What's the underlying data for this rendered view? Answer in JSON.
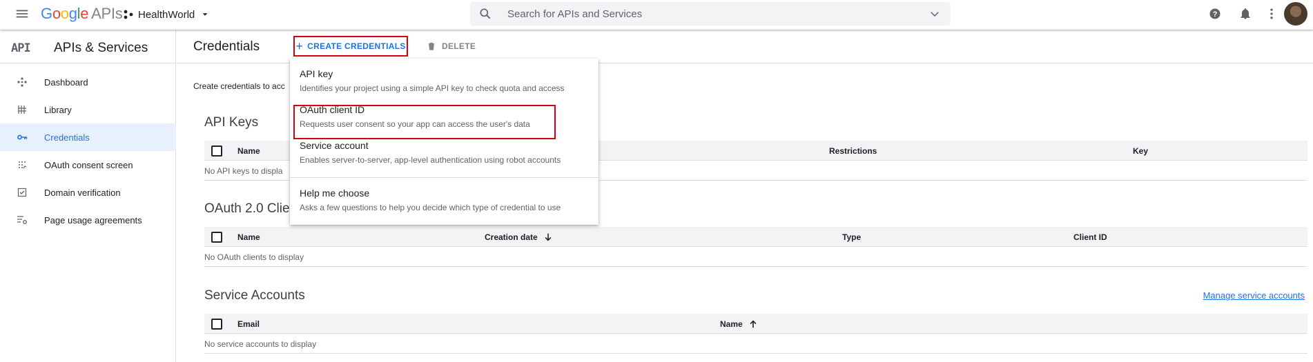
{
  "topbar": {
    "logo_letters": [
      "G",
      "o",
      "o",
      "g",
      "l",
      "e"
    ],
    "logo_suffix": "APIs",
    "project_name": "HealthWorld",
    "search_placeholder": "Search for APIs and Services"
  },
  "sidebar": {
    "logo_text": "API",
    "title": "APIs & Services",
    "items": [
      {
        "label": "Dashboard",
        "icon": "dashboard-icon"
      },
      {
        "label": "Library",
        "icon": "library-icon"
      },
      {
        "label": "Credentials",
        "icon": "key-icon",
        "active": true
      },
      {
        "label": "OAuth consent screen",
        "icon": "consent-icon"
      },
      {
        "label": "Domain verification",
        "icon": "checkbox-icon"
      },
      {
        "label": "Page usage agreements",
        "icon": "settings-list-icon"
      }
    ]
  },
  "main": {
    "title": "Credentials",
    "create_label": "CREATE CREDENTIALS",
    "delete_label": "DELETE",
    "intro": "Create credentials to acc",
    "api_keys": {
      "title": "API Keys",
      "columns": [
        "Name",
        "Restrictions",
        "Key"
      ],
      "empty": "No API keys to displa"
    },
    "oauth": {
      "title": "OAuth 2.0 Clie",
      "columns": [
        "Name",
        "Creation date",
        "Type",
        "Client ID"
      ],
      "empty": "No OAuth clients to display"
    },
    "service_accounts": {
      "title": "Service Accounts",
      "manage_link": "Manage service accounts",
      "columns": [
        "Email",
        "Name"
      ],
      "empty": "No service accounts to display"
    }
  },
  "dropdown": {
    "items": [
      {
        "title": "API key",
        "desc": "Identifies your project using a simple API key to check quota and access"
      },
      {
        "title": "OAuth client ID",
        "desc": "Requests user consent so your app can access the user's data"
      },
      {
        "title": "Service account",
        "desc": "Enables server-to-server, app-level authentication using robot accounts"
      },
      {
        "title": "Help me choose",
        "desc": "Asks a few questions to help you decide which type of credential to use"
      }
    ]
  },
  "colors": {
    "accent": "#1a73e8",
    "highlight_box": "#d7000c",
    "active_bg": "#e8f0fe"
  }
}
